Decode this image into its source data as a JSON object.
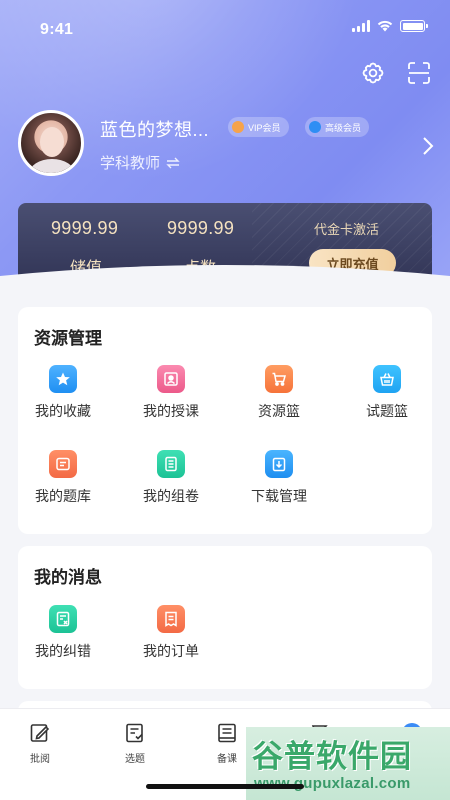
{
  "status_bar": {
    "time": "9:41"
  },
  "header_actions": [
    {
      "name": "settings",
      "icon": "gear-icon"
    },
    {
      "name": "scan",
      "icon": "scan-icon"
    }
  ],
  "profile": {
    "name": "蓝色的梦想...",
    "role": "学科教师",
    "role_switch_icon": "swap-icon",
    "badges": {
      "vip": "VIP会员",
      "senior": "高级会员"
    }
  },
  "wallet": {
    "stored_value": "9999.99",
    "stored_value_label": "储值",
    "points": "9999.99",
    "points_label": "点数",
    "voucher_label": "代金卡激活",
    "recharge_label": "立即充值"
  },
  "resources": {
    "title": "资源管理",
    "items": [
      {
        "label": "我的收藏",
        "icon": "star-icon"
      },
      {
        "label": "我的授课",
        "icon": "lecture-icon"
      },
      {
        "label": "资源篮",
        "icon": "cart-icon"
      },
      {
        "label": "试题篮",
        "icon": "basket-icon"
      },
      {
        "label": "我的题库",
        "icon": "question-bank-icon"
      },
      {
        "label": "我的组卷",
        "icon": "paper-icon"
      },
      {
        "label": "下载管理",
        "icon": "download-icon"
      }
    ]
  },
  "messages": {
    "title": "我的消息",
    "items": [
      {
        "label": "我的纠错",
        "icon": "correction-icon"
      },
      {
        "label": "我的订单",
        "icon": "order-icon"
      }
    ]
  },
  "tabbar": {
    "tabs": [
      {
        "label": "批阅",
        "icon": "edit-icon"
      },
      {
        "label": "选题",
        "icon": "select-icon"
      },
      {
        "label": "备课",
        "icon": "book-icon"
      },
      {
        "label": "",
        "icon": "group-icon"
      },
      {
        "label": "",
        "icon": "profile-icon"
      }
    ]
  },
  "watermark": {
    "main": "谷普软件园",
    "url": "www.gupuxlazal.com"
  },
  "colors": {
    "hero_start": "#a4aef8",
    "hero_end": "#7f8cf2",
    "wallet_bg": "#2e3152",
    "gold_text": "#f5e2c0",
    "recharge_bg": "#f1cf9e"
  }
}
